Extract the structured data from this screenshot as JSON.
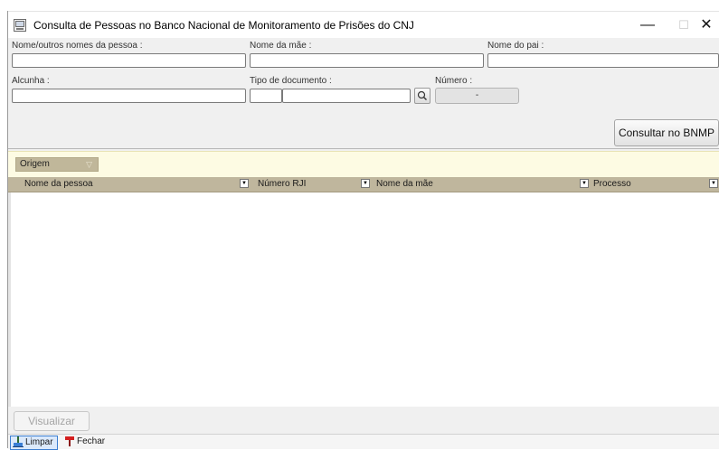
{
  "window": {
    "title": "Consulta de Pessoas no Banco Nacional de Monitoramento de Prisões do CNJ",
    "minimize_glyph": "—",
    "maximize_glyph": "☐",
    "close_glyph": "✕",
    "icon": "app-window-icon"
  },
  "form": {
    "nome_label": "Nome/outros nomes da pessoa :",
    "nome_value": "",
    "mae_label": "Nome da mãe :",
    "mae_value": "",
    "pai_label": "Nome do pai :",
    "pai_value": "",
    "alcunha_label": "Alcunha :",
    "alcunha_value": "",
    "tipo_label": "Tipo de documento :",
    "tipo_code_value": "",
    "tipo_desc_value": "",
    "numero_label": "Número :",
    "numero_value": "-",
    "consult_button": "Consultar no BNMP"
  },
  "group": {
    "chip_label": "Origem",
    "chip_icon": "filter-icon"
  },
  "grid": {
    "columns": [
      "Nome da pessoa",
      "Número RJI",
      "Nome da mãe",
      "Processo"
    ],
    "rows": []
  },
  "bottom": {
    "visualizar_label": "Visualizar"
  },
  "toolbar": {
    "limpar_label": "Limpar",
    "fechar_label": "Fechar"
  },
  "colors": {
    "group_panel_bg": "#fdfbe3",
    "grid_header_bg": "#bfb69d",
    "selected_toolbar_border": "#3d7fd1"
  }
}
